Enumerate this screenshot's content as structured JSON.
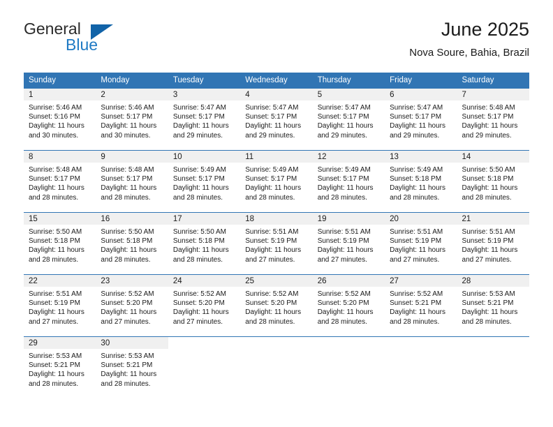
{
  "brand": {
    "name_part1": "General",
    "name_part2": "Blue",
    "triangle_icon": "blue-triangle-icon",
    "color_primary": "#1163a8",
    "color_secondary": "#1f7ac4"
  },
  "header": {
    "title": "June 2025",
    "subtitle": "Nova Soure, Bahia, Brazil"
  },
  "theme": {
    "header_blue": "#3175b4",
    "daynum_bg": "#f0f0f0",
    "text": "#1a1a1a"
  },
  "columns": [
    "Sunday",
    "Monday",
    "Tuesday",
    "Wednesday",
    "Thursday",
    "Friday",
    "Saturday"
  ],
  "weeks": [
    [
      {
        "day": "1",
        "sunrise": "Sunrise: 5:46 AM",
        "sunset": "Sunset: 5:16 PM",
        "daylight1": "Daylight: 11 hours",
        "daylight2": "and 30 minutes."
      },
      {
        "day": "2",
        "sunrise": "Sunrise: 5:46 AM",
        "sunset": "Sunset: 5:17 PM",
        "daylight1": "Daylight: 11 hours",
        "daylight2": "and 30 minutes."
      },
      {
        "day": "3",
        "sunrise": "Sunrise: 5:47 AM",
        "sunset": "Sunset: 5:17 PM",
        "daylight1": "Daylight: 11 hours",
        "daylight2": "and 29 minutes."
      },
      {
        "day": "4",
        "sunrise": "Sunrise: 5:47 AM",
        "sunset": "Sunset: 5:17 PM",
        "daylight1": "Daylight: 11 hours",
        "daylight2": "and 29 minutes."
      },
      {
        "day": "5",
        "sunrise": "Sunrise: 5:47 AM",
        "sunset": "Sunset: 5:17 PM",
        "daylight1": "Daylight: 11 hours",
        "daylight2": "and 29 minutes."
      },
      {
        "day": "6",
        "sunrise": "Sunrise: 5:47 AM",
        "sunset": "Sunset: 5:17 PM",
        "daylight1": "Daylight: 11 hours",
        "daylight2": "and 29 minutes."
      },
      {
        "day": "7",
        "sunrise": "Sunrise: 5:48 AM",
        "sunset": "Sunset: 5:17 PM",
        "daylight1": "Daylight: 11 hours",
        "daylight2": "and 29 minutes."
      }
    ],
    [
      {
        "day": "8",
        "sunrise": "Sunrise: 5:48 AM",
        "sunset": "Sunset: 5:17 PM",
        "daylight1": "Daylight: 11 hours",
        "daylight2": "and 28 minutes."
      },
      {
        "day": "9",
        "sunrise": "Sunrise: 5:48 AM",
        "sunset": "Sunset: 5:17 PM",
        "daylight1": "Daylight: 11 hours",
        "daylight2": "and 28 minutes."
      },
      {
        "day": "10",
        "sunrise": "Sunrise: 5:49 AM",
        "sunset": "Sunset: 5:17 PM",
        "daylight1": "Daylight: 11 hours",
        "daylight2": "and 28 minutes."
      },
      {
        "day": "11",
        "sunrise": "Sunrise: 5:49 AM",
        "sunset": "Sunset: 5:17 PM",
        "daylight1": "Daylight: 11 hours",
        "daylight2": "and 28 minutes."
      },
      {
        "day": "12",
        "sunrise": "Sunrise: 5:49 AM",
        "sunset": "Sunset: 5:17 PM",
        "daylight1": "Daylight: 11 hours",
        "daylight2": "and 28 minutes."
      },
      {
        "day": "13",
        "sunrise": "Sunrise: 5:49 AM",
        "sunset": "Sunset: 5:18 PM",
        "daylight1": "Daylight: 11 hours",
        "daylight2": "and 28 minutes."
      },
      {
        "day": "14",
        "sunrise": "Sunrise: 5:50 AM",
        "sunset": "Sunset: 5:18 PM",
        "daylight1": "Daylight: 11 hours",
        "daylight2": "and 28 minutes."
      }
    ],
    [
      {
        "day": "15",
        "sunrise": "Sunrise: 5:50 AM",
        "sunset": "Sunset: 5:18 PM",
        "daylight1": "Daylight: 11 hours",
        "daylight2": "and 28 minutes."
      },
      {
        "day": "16",
        "sunrise": "Sunrise: 5:50 AM",
        "sunset": "Sunset: 5:18 PM",
        "daylight1": "Daylight: 11 hours",
        "daylight2": "and 28 minutes."
      },
      {
        "day": "17",
        "sunrise": "Sunrise: 5:50 AM",
        "sunset": "Sunset: 5:18 PM",
        "daylight1": "Daylight: 11 hours",
        "daylight2": "and 28 minutes."
      },
      {
        "day": "18",
        "sunrise": "Sunrise: 5:51 AM",
        "sunset": "Sunset: 5:19 PM",
        "daylight1": "Daylight: 11 hours",
        "daylight2": "and 27 minutes."
      },
      {
        "day": "19",
        "sunrise": "Sunrise: 5:51 AM",
        "sunset": "Sunset: 5:19 PM",
        "daylight1": "Daylight: 11 hours",
        "daylight2": "and 27 minutes."
      },
      {
        "day": "20",
        "sunrise": "Sunrise: 5:51 AM",
        "sunset": "Sunset: 5:19 PM",
        "daylight1": "Daylight: 11 hours",
        "daylight2": "and 27 minutes."
      },
      {
        "day": "21",
        "sunrise": "Sunrise: 5:51 AM",
        "sunset": "Sunset: 5:19 PM",
        "daylight1": "Daylight: 11 hours",
        "daylight2": "and 27 minutes."
      }
    ],
    [
      {
        "day": "22",
        "sunrise": "Sunrise: 5:51 AM",
        "sunset": "Sunset: 5:19 PM",
        "daylight1": "Daylight: 11 hours",
        "daylight2": "and 27 minutes."
      },
      {
        "day": "23",
        "sunrise": "Sunrise: 5:52 AM",
        "sunset": "Sunset: 5:20 PM",
        "daylight1": "Daylight: 11 hours",
        "daylight2": "and 27 minutes."
      },
      {
        "day": "24",
        "sunrise": "Sunrise: 5:52 AM",
        "sunset": "Sunset: 5:20 PM",
        "daylight1": "Daylight: 11 hours",
        "daylight2": "and 27 minutes."
      },
      {
        "day": "25",
        "sunrise": "Sunrise: 5:52 AM",
        "sunset": "Sunset: 5:20 PM",
        "daylight1": "Daylight: 11 hours",
        "daylight2": "and 28 minutes."
      },
      {
        "day": "26",
        "sunrise": "Sunrise: 5:52 AM",
        "sunset": "Sunset: 5:20 PM",
        "daylight1": "Daylight: 11 hours",
        "daylight2": "and 28 minutes."
      },
      {
        "day": "27",
        "sunrise": "Sunrise: 5:52 AM",
        "sunset": "Sunset: 5:21 PM",
        "daylight1": "Daylight: 11 hours",
        "daylight2": "and 28 minutes."
      },
      {
        "day": "28",
        "sunrise": "Sunrise: 5:53 AM",
        "sunset": "Sunset: 5:21 PM",
        "daylight1": "Daylight: 11 hours",
        "daylight2": "and 28 minutes."
      }
    ],
    [
      {
        "day": "29",
        "sunrise": "Sunrise: 5:53 AM",
        "sunset": "Sunset: 5:21 PM",
        "daylight1": "Daylight: 11 hours",
        "daylight2": "and 28 minutes."
      },
      {
        "day": "30",
        "sunrise": "Sunrise: 5:53 AM",
        "sunset": "Sunset: 5:21 PM",
        "daylight1": "Daylight: 11 hours",
        "daylight2": "and 28 minutes."
      },
      {
        "day": "",
        "sunrise": "",
        "sunset": "",
        "daylight1": "",
        "daylight2": ""
      },
      {
        "day": "",
        "sunrise": "",
        "sunset": "",
        "daylight1": "",
        "daylight2": ""
      },
      {
        "day": "",
        "sunrise": "",
        "sunset": "",
        "daylight1": "",
        "daylight2": ""
      },
      {
        "day": "",
        "sunrise": "",
        "sunset": "",
        "daylight1": "",
        "daylight2": ""
      },
      {
        "day": "",
        "sunrise": "",
        "sunset": "",
        "daylight1": "",
        "daylight2": ""
      }
    ]
  ]
}
